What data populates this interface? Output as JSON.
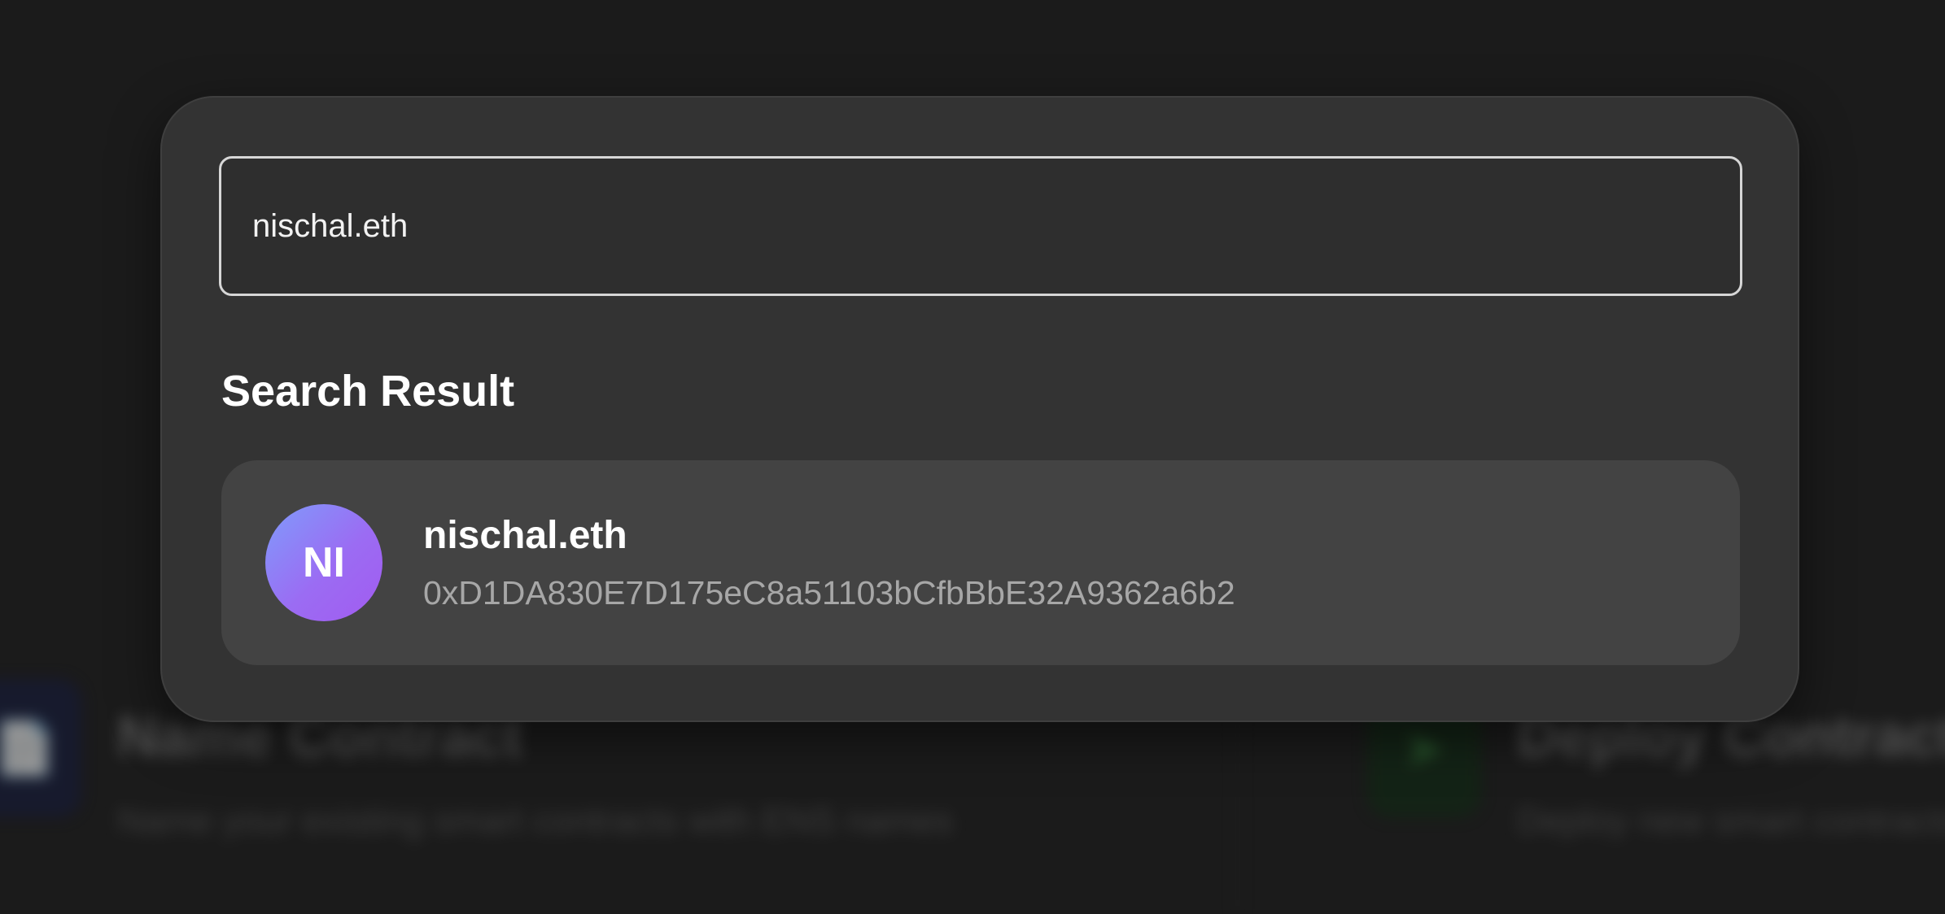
{
  "search": {
    "value": "nischal.eth"
  },
  "results": {
    "title": "Search Result",
    "items": [
      {
        "avatar_initials": "NI",
        "name": "nischal.eth",
        "address": "0xD1DA830E7D175eC8a51103bCfbBbE32A9362a6b2"
      }
    ]
  },
  "background": {
    "cards": [
      {
        "icon": "document-icon",
        "title": "Name Contract",
        "description": "Name your existing smart contracts with ENS names"
      },
      {
        "icon": "rocket-icon",
        "title": "Deploy Contract",
        "description": "Deploy new smart contracts"
      }
    ]
  },
  "colors": {
    "backdrop": "#1b1b1b",
    "modal": "#333333",
    "result_card": "#434343",
    "avatar_gradient_start": "#7f9cfb",
    "avatar_gradient_end": "#a25bf0"
  }
}
